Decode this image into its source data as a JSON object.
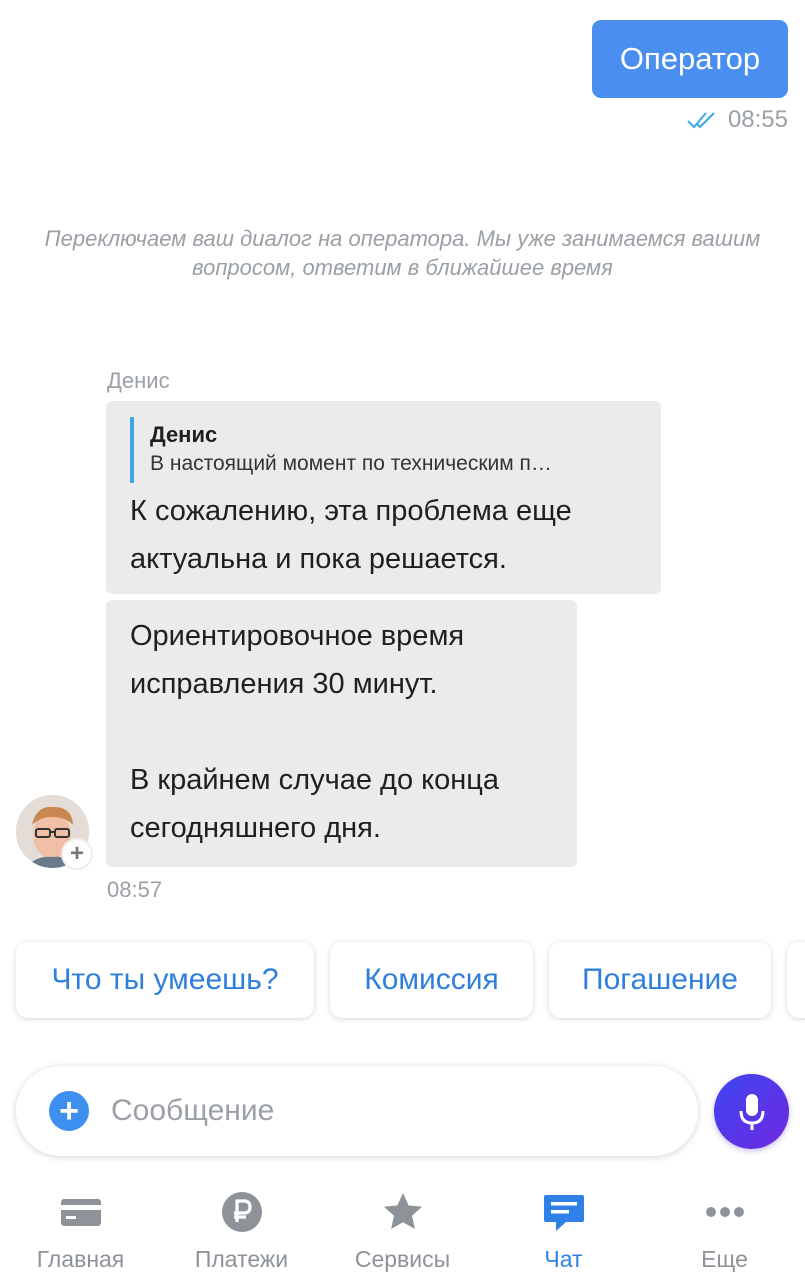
{
  "outgoing": {
    "text": "Оператор",
    "time": "08:55",
    "status_icon": "double-check-icon"
  },
  "system_note": "Переключаем ваш диалог на оператора. Мы уже занимаемся вашим вопросом, ответим в ближайшее время",
  "incoming": {
    "sender": "Денис",
    "quote": {
      "author": "Денис",
      "text": "В настоящий момент по техническим п…"
    },
    "message1": "К сожалению, эта проблема еще актуальна и пока решается.",
    "message2": {
      "line1": "Ориентировочное время",
      "line2": "исправления 30 минут.",
      "line3": "В крайнем случае до конца",
      "line4": "сегодняшнего дня."
    },
    "time": "08:57"
  },
  "chips": [
    "Что ты умеешь?",
    "Комиссия",
    "Погашение"
  ],
  "composer": {
    "placeholder": "Сообщение",
    "value": ""
  },
  "tabs": [
    {
      "label": "Главная",
      "icon": "card-icon",
      "active": false
    },
    {
      "label": "Платежи",
      "icon": "ruble-icon",
      "active": false
    },
    {
      "label": "Сервисы",
      "icon": "star-icon",
      "active": false
    },
    {
      "label": "Чат",
      "icon": "chat-icon",
      "active": true
    },
    {
      "label": "Еще",
      "icon": "more-icon",
      "active": false
    }
  ],
  "colors": {
    "accent": "#4a8ff0",
    "tab_active": "#2f80e7",
    "bubble_in": "#ebebeb",
    "mic_gradient_start": "#3c46f2",
    "mic_gradient_end": "#6f28e0"
  }
}
